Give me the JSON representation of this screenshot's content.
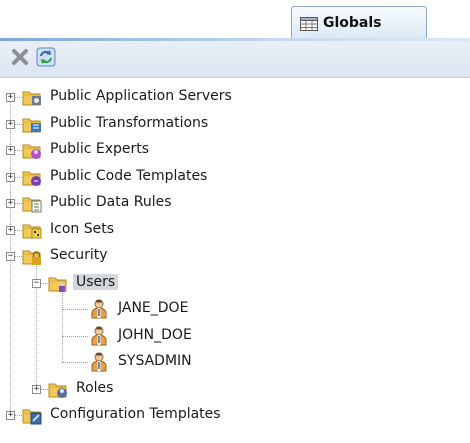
{
  "tab": {
    "label": "Globals",
    "icon": "grid-window-icon"
  },
  "toolbar": {
    "delete_icon": "close-icon",
    "refresh_icon": "refresh-icon"
  },
  "tree": {
    "items": [
      {
        "label": "Public Application Servers",
        "icon": "folder-server-icon",
        "expand": "+"
      },
      {
        "label": "Public Transformations",
        "icon": "folder-transform-icon",
        "expand": "+"
      },
      {
        "label": "Public Experts",
        "icon": "folder-expert-icon",
        "expand": "+"
      },
      {
        "label": "Public Code Templates",
        "icon": "folder-code-icon",
        "expand": "+"
      },
      {
        "label": "Public Data Rules",
        "icon": "folder-rules-icon",
        "expand": "+"
      },
      {
        "label": "Icon Sets",
        "icon": "folder-iconset-icon",
        "expand": "+"
      },
      {
        "label": "Security",
        "icon": "folder-lock-icon",
        "expand": "−"
      },
      {
        "label": "Users",
        "icon": "folder-users-icon",
        "expand": "−"
      },
      {
        "label": "JANE_DOE",
        "icon": "user-icon"
      },
      {
        "label": "JOHN_DOE",
        "icon": "user-icon"
      },
      {
        "label": "SYSADMIN",
        "icon": "user-icon"
      },
      {
        "label": "Roles",
        "icon": "folder-roles-icon",
        "expand": "+"
      },
      {
        "label": "Configuration Templates",
        "icon": "folder-config-icon",
        "expand": "+"
      }
    ]
  },
  "colors": {
    "selection": "#d4d8de",
    "toolbar": "#e3eaf4",
    "tab_border": "#8aa6c8"
  }
}
